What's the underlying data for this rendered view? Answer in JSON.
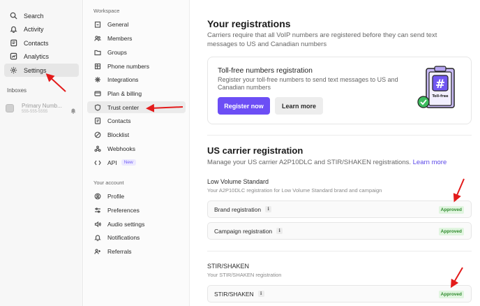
{
  "sidebar": {
    "items": [
      {
        "label": "Search",
        "icon": "search-icon"
      },
      {
        "label": "Activity",
        "icon": "bell-icon"
      },
      {
        "label": "Contacts",
        "icon": "contacts-icon"
      },
      {
        "label": "Analytics",
        "icon": "chart-icon"
      },
      {
        "label": "Settings",
        "icon": "gear-icon",
        "active": true
      }
    ],
    "inboxes_label": "Inboxes",
    "inbox": {
      "name": "Primary Numb...",
      "number": "555-555-5555"
    }
  },
  "settings_nav": {
    "workspace_label": "Workspace",
    "workspace_items": [
      {
        "label": "General",
        "icon": "building-icon"
      },
      {
        "label": "Members",
        "icon": "members-icon"
      },
      {
        "label": "Groups",
        "icon": "folder-icon"
      },
      {
        "label": "Phone numbers",
        "icon": "phone-icon"
      },
      {
        "label": "Integrations",
        "icon": "integrations-icon"
      },
      {
        "label": "Plan & billing",
        "icon": "billing-icon"
      },
      {
        "label": "Trust center",
        "icon": "shield-icon",
        "active": true
      },
      {
        "label": "Contacts",
        "icon": "contacts-icon"
      },
      {
        "label": "Blocklist",
        "icon": "block-icon"
      },
      {
        "label": "Webhooks",
        "icon": "webhook-icon"
      },
      {
        "label": "API",
        "icon": "api-icon",
        "badge": "New"
      }
    ],
    "account_label": "Your account",
    "account_items": [
      {
        "label": "Profile",
        "icon": "profile-icon"
      },
      {
        "label": "Preferences",
        "icon": "sliders-icon"
      },
      {
        "label": "Audio settings",
        "icon": "speaker-icon"
      },
      {
        "label": "Notifications",
        "icon": "bell-icon"
      },
      {
        "label": "Referrals",
        "icon": "referrals-icon"
      }
    ]
  },
  "main": {
    "title": "Your registrations",
    "subtitle": "Carriers require that all VoIP numbers are registered before they can send text messages to US and Canadian numbers",
    "tollfree": {
      "title": "Toll-free numbers registration",
      "text": "Register your toll-free numbers to send text messages to US and Canadian numbers",
      "register_label": "Register now",
      "learn_label": "Learn more",
      "illus_text": "Toll-free"
    },
    "us_carrier": {
      "title": "US carrier registration",
      "subtitle": "Manage your US carrier A2P10DLC and STIR/SHAKEN registrations.",
      "link": "Learn more",
      "lvs_label": "Low Volume Standard",
      "lvs_hint": "Your A2P10DLC registration for Low Volume Standard brand and campaign",
      "brand_label": "Brand registration",
      "campaign_label": "Campaign registration",
      "status": "Approved"
    },
    "stir": {
      "label": "STIR/SHAKEN",
      "hint": "Your STIR/SHAKEN registration",
      "row_label": "STIR/SHAKEN",
      "status": "Approved"
    }
  },
  "colors": {
    "accent": "#6c4ef5",
    "approved_bg": "#e1f5e0",
    "approved_text": "#2f8a2d",
    "annotation_arrow": "#e31b1b"
  }
}
